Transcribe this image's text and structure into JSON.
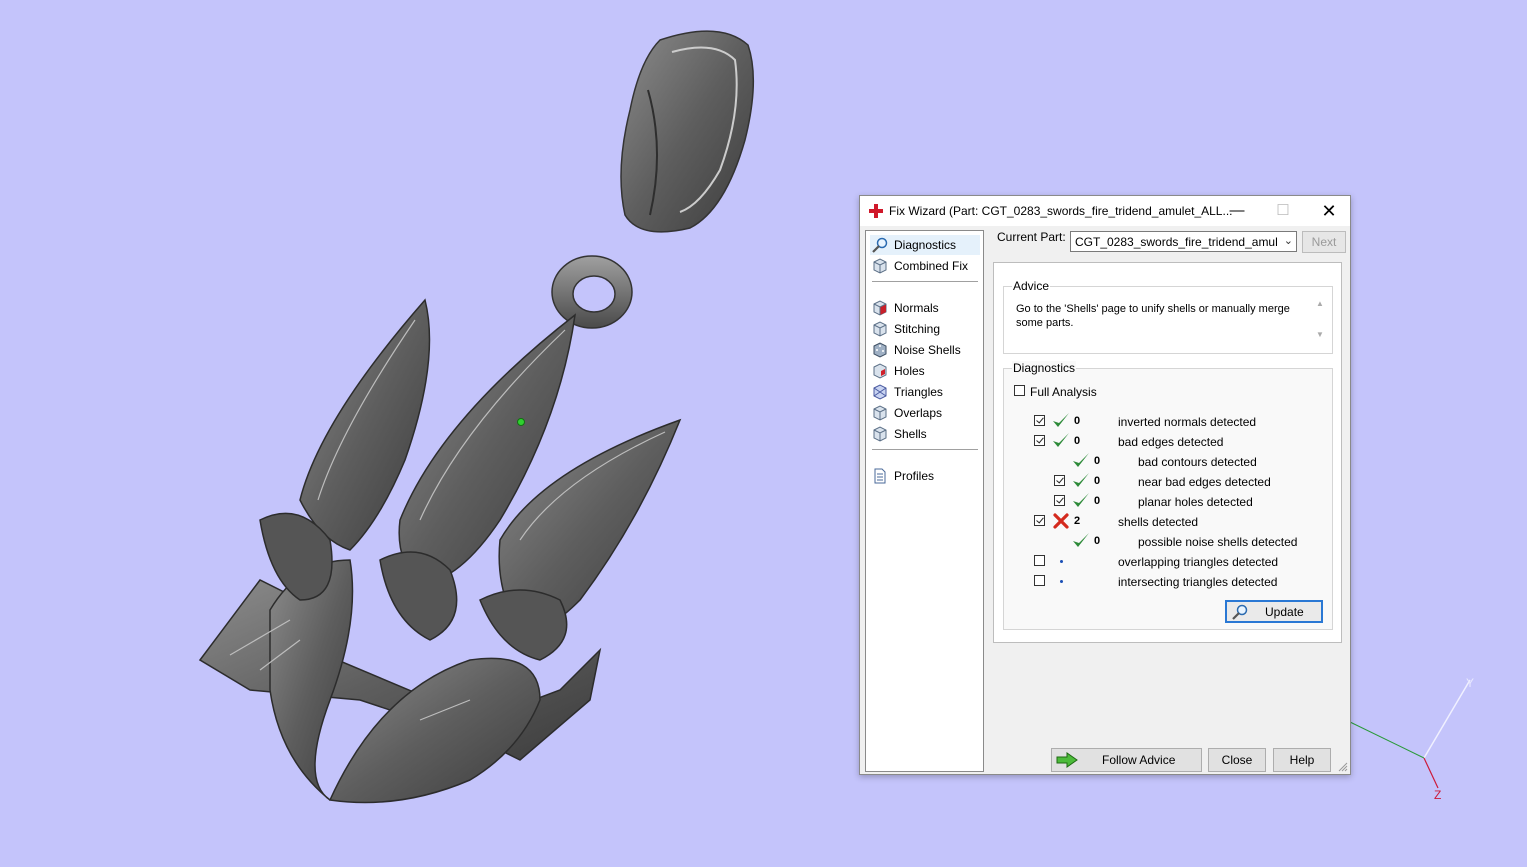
{
  "viewport": {
    "background": "#c4c4fb",
    "axes": {
      "y": "Y",
      "z": "Z"
    }
  },
  "dialog": {
    "title": "Fix Wizard (Part: CGT_0283_swords_fire_tridend_amulet_ALL...",
    "controls": {
      "minimize": "—",
      "maximize": "☐",
      "close": "✕"
    },
    "nav": {
      "items": [
        {
          "label": "Diagnostics",
          "icon": "magnifier-icon",
          "selected": true
        },
        {
          "label": "Combined Fix",
          "icon": "cube-icon"
        },
        {
          "label": "Normals",
          "icon": "cube-red-icon"
        },
        {
          "label": "Stitching",
          "icon": "cube-icon"
        },
        {
          "label": "Noise Shells",
          "icon": "cube-dotted-icon"
        },
        {
          "label": "Holes",
          "icon": "cube-hole-icon"
        },
        {
          "label": "Triangles",
          "icon": "cube-icon"
        },
        {
          "label": "Overlaps",
          "icon": "cube-icon"
        },
        {
          "label": "Shells",
          "icon": "cube-icon"
        },
        {
          "label": "Profiles",
          "icon": "document-icon"
        }
      ]
    },
    "current_part": {
      "label": "Current Part:",
      "value": "CGT_0283_swords_fire_tridend_amulet_AL",
      "next_label": "Next"
    },
    "advice": {
      "title": "Advice",
      "text": "Go to the 'Shells' page to unify shells or manually merge some parts."
    },
    "diagnostics": {
      "title": "Diagnostics",
      "full_analysis_label": "Full Analysis",
      "full_analysis_checked": false,
      "rows": [
        {
          "checkbox": true,
          "checked": true,
          "status": "ok",
          "count": "0",
          "label": "inverted normals detected",
          "indent": 0
        },
        {
          "checkbox": true,
          "checked": true,
          "status": "ok",
          "count": "0",
          "label": "bad edges detected",
          "indent": 0
        },
        {
          "checkbox": false,
          "checked": false,
          "status": "ok",
          "count": "0",
          "label": "bad contours detected",
          "indent": 1
        },
        {
          "checkbox": true,
          "checked": true,
          "status": "ok",
          "count": "0",
          "label": "near bad edges detected",
          "indent": 1
        },
        {
          "checkbox": true,
          "checked": true,
          "status": "ok",
          "count": "0",
          "label": "planar holes detected",
          "indent": 1
        },
        {
          "checkbox": true,
          "checked": true,
          "status": "error",
          "count": "2",
          "label": "shells detected",
          "indent": 0
        },
        {
          "checkbox": false,
          "checked": false,
          "status": "ok",
          "count": "0",
          "label": "possible noise shells detected",
          "indent": 1
        },
        {
          "checkbox": true,
          "checked": false,
          "status": "none",
          "count": "",
          "label": "overlapping triangles detected",
          "indent": 0
        },
        {
          "checkbox": true,
          "checked": false,
          "status": "none",
          "count": "",
          "label": "intersecting triangles detected",
          "indent": 0
        }
      ],
      "update_label": "Update"
    },
    "buttons": {
      "follow_advice": "Follow Advice",
      "close": "Close",
      "help": "Help"
    },
    "colors": {
      "ok": "#2e8b3a",
      "error": "#d42a1e",
      "accent": "#2a78d4"
    }
  }
}
